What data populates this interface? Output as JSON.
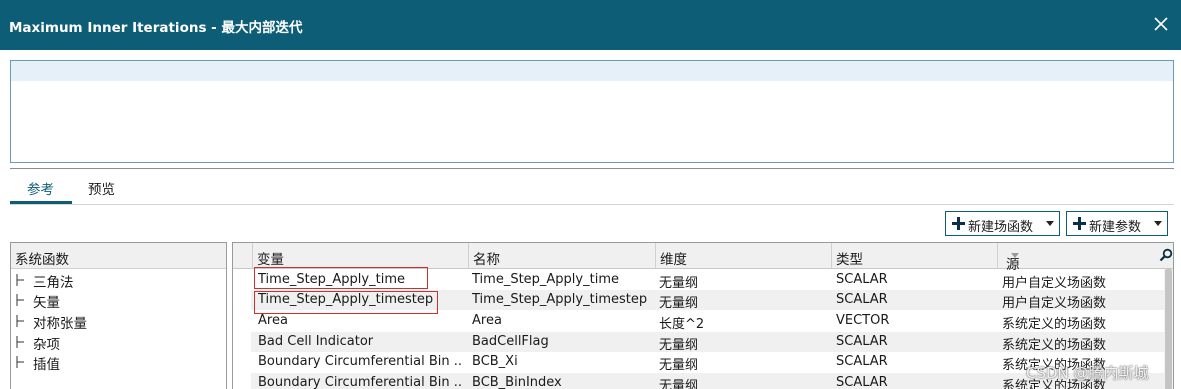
{
  "window": {
    "title": "Maximum Inner Iterations - 最大内部迭代"
  },
  "tabs": [
    {
      "label": "参考",
      "active": true
    },
    {
      "label": "预览",
      "active": false
    }
  ],
  "toolbar": {
    "new_field_function": "新建场函数",
    "new_parameter": "新建参数"
  },
  "left_panel": {
    "header": "系统函数",
    "items": [
      {
        "label": "三角法"
      },
      {
        "label": "矢量"
      },
      {
        "label": "对称张量"
      },
      {
        "label": "杂项"
      },
      {
        "label": "插值"
      }
    ]
  },
  "table": {
    "columns": [
      "变量",
      "名称",
      "维度",
      "类型",
      "源"
    ],
    "sort_column": "源",
    "rows": [
      {
        "variable": "Time_Step_Apply_time",
        "name": "Time_Step_Apply_time",
        "dimension": "无量纲",
        "type": "SCALAR",
        "source": "用户自定义场函数",
        "highlighted": true
      },
      {
        "variable": "Time_Step_Apply_timestep",
        "name": "Time_Step_Apply_timestep",
        "dimension": "无量纲",
        "type": "SCALAR",
        "source": "用户自定义场函数",
        "highlighted": true
      },
      {
        "variable": "Area",
        "name": "Area",
        "dimension": "长度^2",
        "type": "VECTOR",
        "source": "系统定义的场函数",
        "highlighted": false
      },
      {
        "variable": "Bad Cell Indicator",
        "name": "BadCellFlag",
        "dimension": "无量纲",
        "type": "SCALAR",
        "source": "系统定义的场函数",
        "highlighted": false
      },
      {
        "variable": "Boundary Circumferential Bin ...",
        "name": "BCB_Xi",
        "dimension": "无量纲",
        "type": "SCALAR",
        "source": "系统定义的场函数",
        "highlighted": false
      },
      {
        "variable": "Boundary Circumferential Bin ...",
        "name": "BCB_BinIndex",
        "dimension": "无量纲",
        "type": "SCALAR",
        "source": "系统定义的场函数",
        "highlighted": false
      }
    ]
  },
  "watermark": "CSDN @腾内斯城",
  "colors": {
    "titlebar": "#0d5d77",
    "accent": "#0d5d77",
    "highlight_box": "#d0302c"
  },
  "icons": [
    "close-icon",
    "plus-icon",
    "caret-down-icon",
    "tree-expand-icon",
    "search-icon"
  ]
}
